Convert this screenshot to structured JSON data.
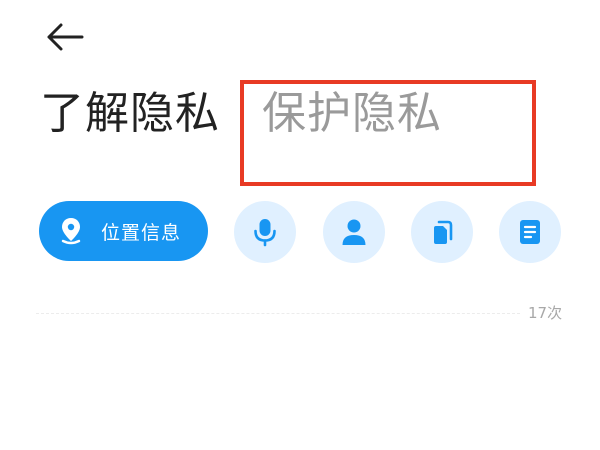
{
  "header": {
    "back_icon": "arrow-left-icon"
  },
  "tabs": [
    {
      "label": "了解隐私",
      "state": "selected"
    },
    {
      "label": "保护隐私",
      "state": "unselected"
    }
  ],
  "permission_chips": [
    {
      "label": "位置信息",
      "icon": "location-pin-icon",
      "active": true
    },
    {
      "label": "",
      "icon": "microphone-icon",
      "active": false
    },
    {
      "label": "",
      "icon": "contact-person-icon",
      "active": false
    },
    {
      "label": "",
      "icon": "files-icon",
      "active": false
    },
    {
      "label": "",
      "icon": "notes-icon",
      "active": false
    }
  ],
  "access_count": "17次",
  "colors": {
    "accent": "#1896f2",
    "chip_inactive_bg": "#e0f0ff",
    "highlight_border": "#e83a24",
    "tab_selected": "#222222",
    "tab_unselected": "#9a9a9a"
  }
}
